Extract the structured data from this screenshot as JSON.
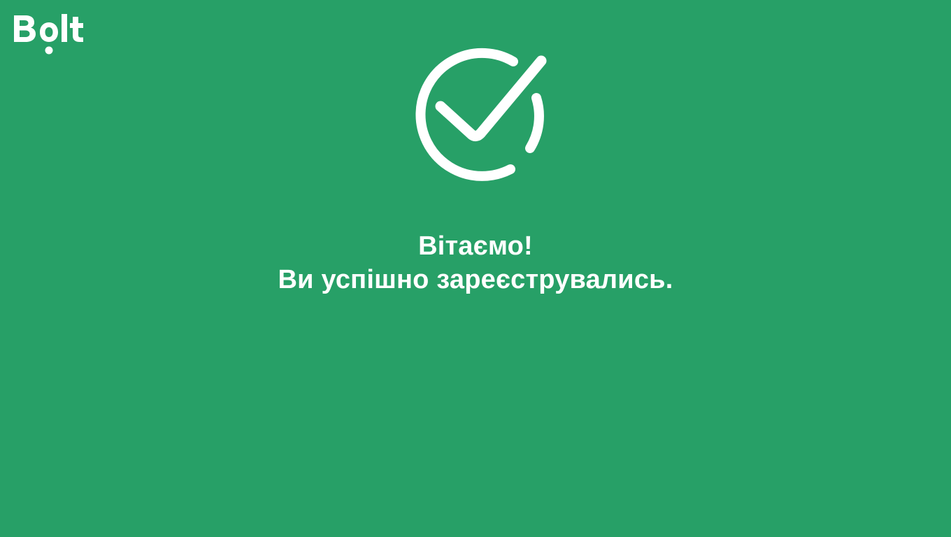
{
  "brand": {
    "logo_text": "Bolt",
    "logo_icon": "bolt-logo",
    "background_color": "#27a067",
    "foreground_color": "#ffffff"
  },
  "status": {
    "icon": "check-circle-icon"
  },
  "message": {
    "greeting": "Вітаємо!",
    "confirmation": "Ви успішно зареєструвались."
  }
}
